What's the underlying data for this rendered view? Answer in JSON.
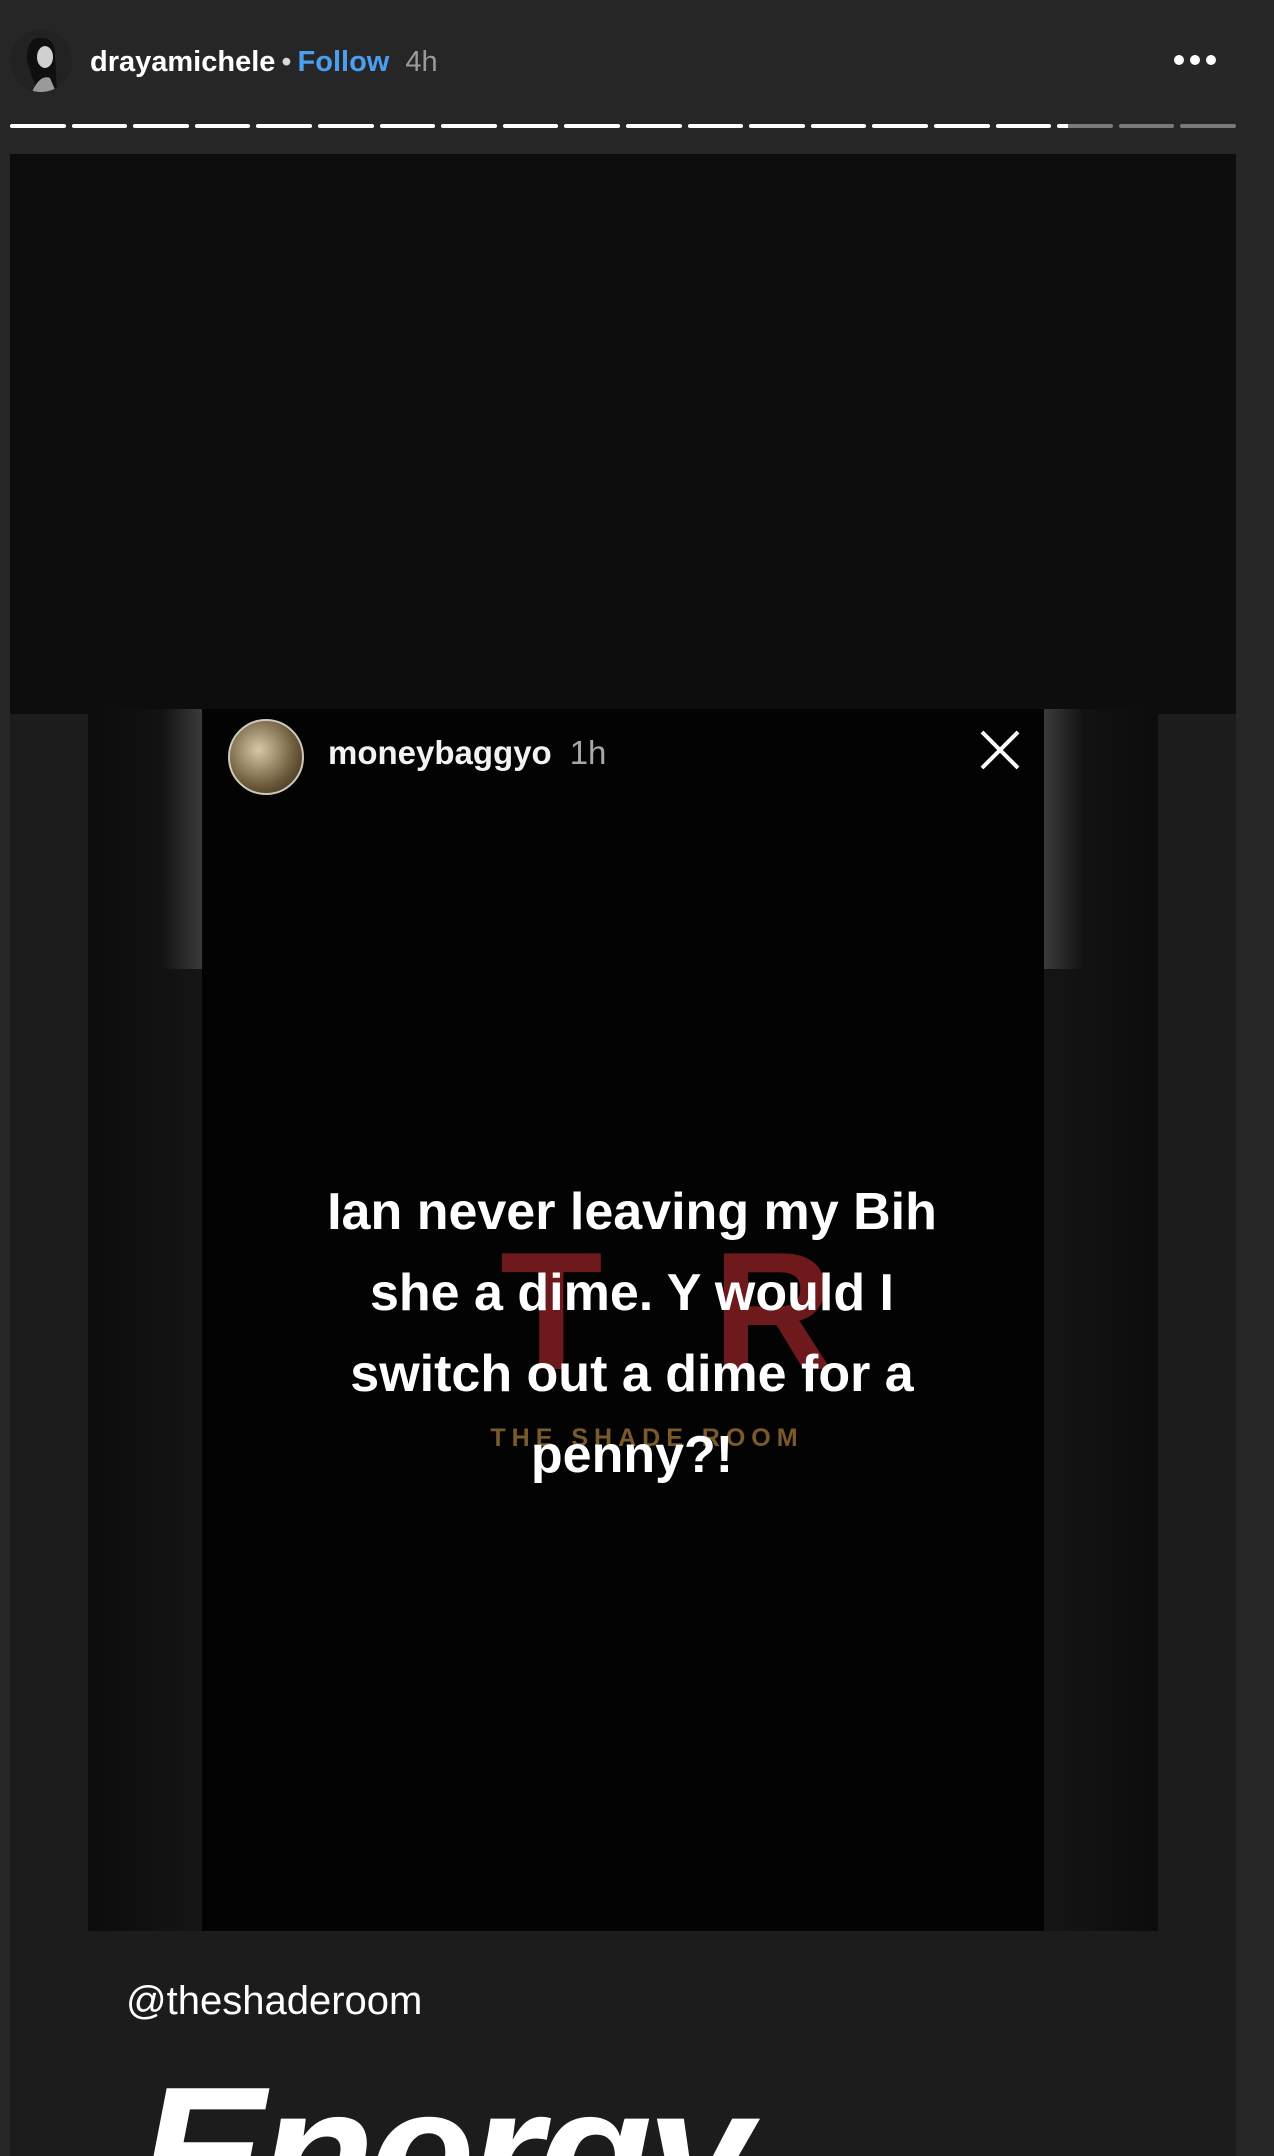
{
  "header": {
    "username": "drayamichele",
    "separator": "•",
    "follow_label": "Follow",
    "age": "4h",
    "more_icon": "more-horizontal-icon"
  },
  "progress": {
    "segment_count": 20,
    "current_segment_index": 17,
    "current_segment_fraction": 0.2
  },
  "repost": {
    "username": "moneybaggyo",
    "age": "1h",
    "close_icon": "close-icon",
    "quote_lines": [
      "Ian never leaving my Bih",
      "she a dime. Y would I",
      "switch out a dime for a",
      "penny?!"
    ],
    "watermark_letters": "TR",
    "watermark_caption": "THE SHADE ROOM",
    "watermark_color": "#6e1a1d",
    "caption_color": "#7a5a2a"
  },
  "mention": "@theshaderoom",
  "sticker_text": "Energy.",
  "colors": {
    "follow": "#4c9ef0",
    "background": "#262626",
    "story_bg": "#1c1c1c"
  }
}
